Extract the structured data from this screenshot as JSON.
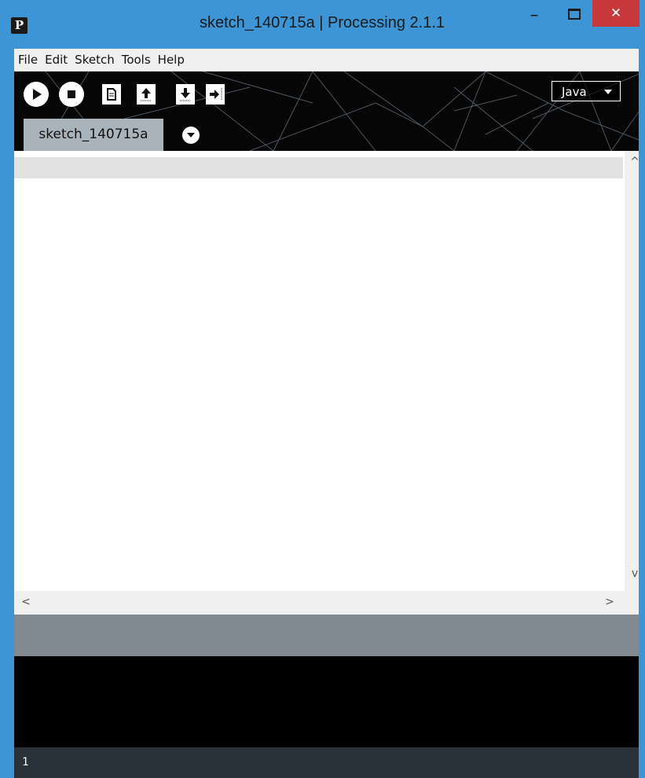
{
  "window": {
    "title": "sketch_140715a | Processing 2.1.1",
    "app_icon": "P",
    "minimize_symbol": "–",
    "close_symbol": "✕"
  },
  "menu": [
    {
      "label": "File"
    },
    {
      "label": "Edit"
    },
    {
      "label": "Sketch"
    },
    {
      "label": "Tools"
    },
    {
      "label": "Help"
    }
  ],
  "toolbar": {
    "buttons": [
      {
        "name": "run-button",
        "icon": "play-icon"
      },
      {
        "name": "stop-button",
        "icon": "stop-icon"
      },
      {
        "name": "new-button",
        "icon": "new-file-icon"
      },
      {
        "name": "open-button",
        "icon": "upload-arrow-icon"
      },
      {
        "name": "save-button",
        "icon": "download-arrow-icon"
      },
      {
        "name": "export-button",
        "icon": "export-arrow-icon"
      }
    ],
    "mode_label": "Java"
  },
  "tabs": [
    {
      "label": "sketch_140715a"
    }
  ],
  "editor": {
    "scroll_up": "^",
    "scroll_down": "v",
    "scroll_left": "<",
    "scroll_right": ">"
  },
  "footer": {
    "line_number": "1"
  },
  "colors": {
    "titlebar": "#3d95d6",
    "close_button": "#c7383a",
    "toolbar_bg": "#060606",
    "tab_bg": "#a8b3bc",
    "status_bar": "#818a91",
    "console_bg": "#000000",
    "footer_bg": "#29323a"
  }
}
